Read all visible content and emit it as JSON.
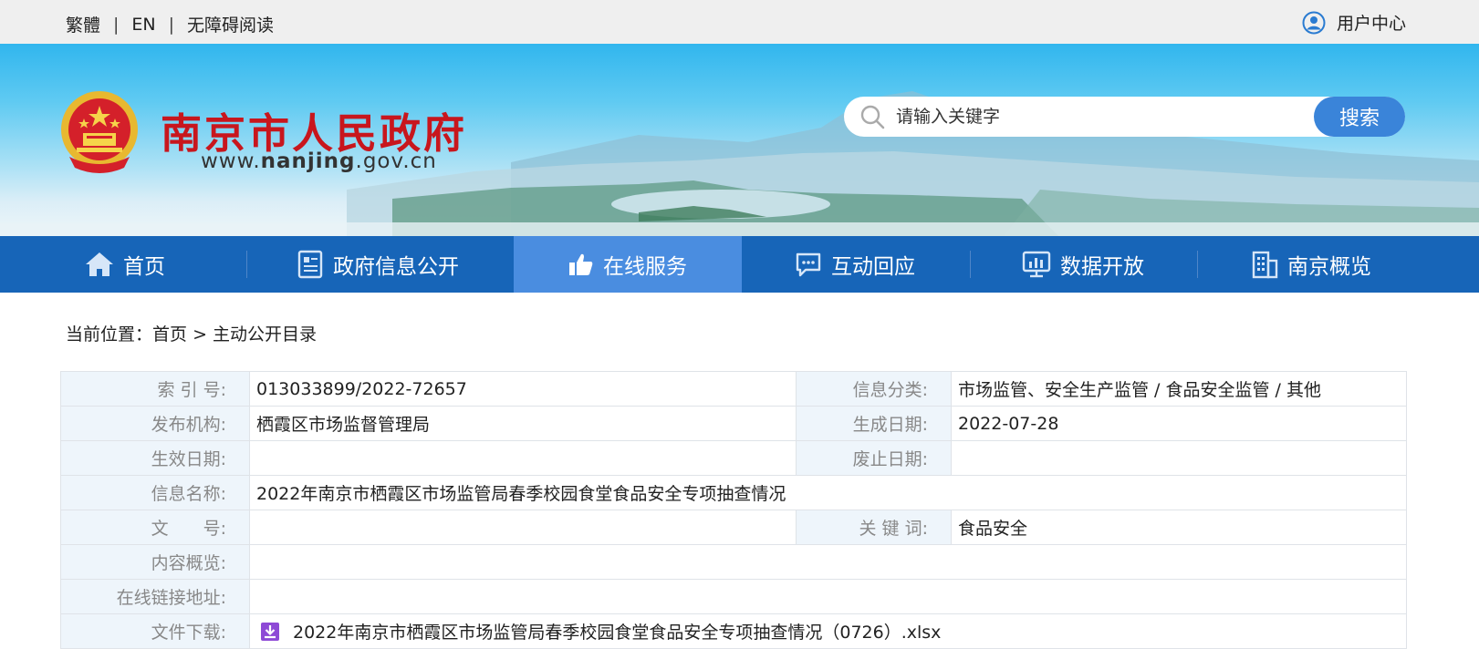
{
  "topbar": {
    "links": [
      "繁體",
      "EN",
      "无障碍阅读"
    ],
    "separator": "|",
    "user_center": "用户中心"
  },
  "header": {
    "title": "南京市人民政府",
    "url_prefix": "www.",
    "url_bold": "nanjing",
    "url_suffix": ".gov.cn",
    "search_placeholder": "请输入关键字",
    "search_button": "搜索"
  },
  "nav": {
    "items": [
      {
        "label": "首页",
        "icon": "home-icon"
      },
      {
        "label": "政府信息公开",
        "icon": "document-icon"
      },
      {
        "label": "在线服务",
        "icon": "thumbs-up-icon",
        "active": true
      },
      {
        "label": "互动回应",
        "icon": "chat-icon"
      },
      {
        "label": "数据开放",
        "icon": "chart-icon"
      },
      {
        "label": "南京概览",
        "icon": "building-icon"
      }
    ]
  },
  "breadcrumb": {
    "prefix": "当前位置：",
    "home": "首页",
    "sep": ">",
    "current": "主动公开目录"
  },
  "info": {
    "index_label": "索 引 号:",
    "index_value": "013033899/2022-72657",
    "category_label": "信息分类:",
    "category_value": "市场监管、安全生产监管 / 食品安全监管 / 其他",
    "publisher_label": "发布机构:",
    "publisher_value": "栖霞区市场监督管理局",
    "created_label": "生成日期:",
    "created_value": "2022-07-28",
    "effective_label": "生效日期:",
    "effective_value": "",
    "expired_label": "废止日期:",
    "expired_value": "",
    "name_label": "信息名称:",
    "name_value": "2022年南京市栖霞区市场监管局春季校园食堂食品安全专项抽查情况",
    "docno_label": "文　　号:",
    "docno_value": "",
    "keywords_label": "关 键 词:",
    "keywords_value": "食品安全",
    "summary_label": "内容概览:",
    "summary_value": "",
    "link_label": "在线链接地址:",
    "link_value": "",
    "download_label": "文件下载:",
    "download_value": "2022年南京市栖霞区市场监管局春季校园食堂食品安全专项抽查情况（0726）.xlsx"
  },
  "colors": {
    "nav_bg": "#1765b8",
    "nav_active": "#4a8de0",
    "title_red": "#c8161d",
    "search_button": "#3a84d9",
    "label_bg": "#eef5fb"
  }
}
